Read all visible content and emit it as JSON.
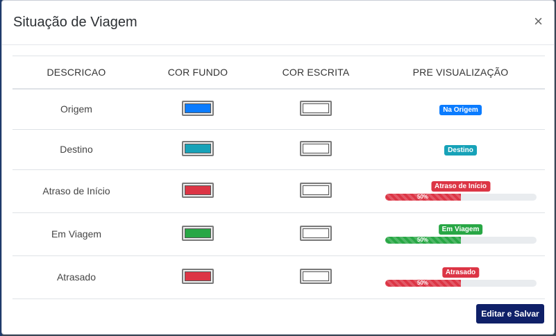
{
  "modal": {
    "title": "Situação de Viagem",
    "close_symbol": "×",
    "save_label": "Editar e Salvar"
  },
  "table": {
    "headers": [
      "DESCRICAO",
      "COR FUNDO",
      "COR ESCRITA",
      "PRE VISUALIZAÇÃO"
    ],
    "rows": [
      {
        "descricao": "Origem",
        "cor_fundo": "#0b7cff",
        "cor_escrita": "#ffffff",
        "badge": "Na Origem",
        "progress": null
      },
      {
        "descricao": "Destino",
        "cor_fundo": "#17a2b8",
        "cor_escrita": "#ffffff",
        "badge": "Destino",
        "progress": null
      },
      {
        "descricao": "Atraso de Início",
        "cor_fundo": "#dc3545",
        "cor_escrita": "#ffffff",
        "badge": "Atraso de Início",
        "progress": {
          "value": 50,
          "label": "50%"
        }
      },
      {
        "descricao": "Em Viagem",
        "cor_fundo": "#28a745",
        "cor_escrita": "#ffffff",
        "badge": "Em Viagem",
        "progress": {
          "value": 50,
          "label": "50%"
        }
      },
      {
        "descricao": "Atrasado",
        "cor_fundo": "#dc3545",
        "cor_escrita": "#ffffff",
        "badge": "Atrasado",
        "progress": {
          "value": 50,
          "label": "50%"
        }
      }
    ]
  }
}
